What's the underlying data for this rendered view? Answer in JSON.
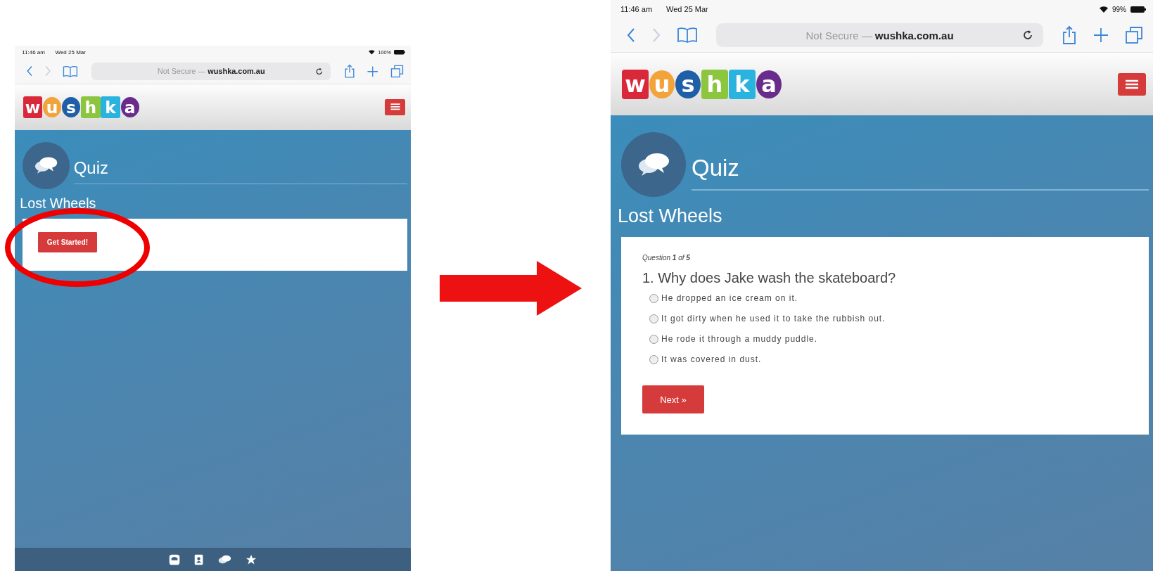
{
  "screens": [
    {
      "kind": "start",
      "status_bar": {
        "time": "11:46 am",
        "date": "Wed 25 Mar",
        "battery": "100%"
      },
      "address_bar": {
        "security": "Not Secure —",
        "domain": "wushka.com.au"
      },
      "logo_letters": [
        {
          "letter": "w",
          "color": "#d9283a",
          "kind": "square"
        },
        {
          "letter": "u",
          "color": "#f2a33a",
          "kind": "circle"
        },
        {
          "letter": "s",
          "color": "#1f5fa8",
          "kind": "circle"
        },
        {
          "letter": "h",
          "color": "#8cc63f",
          "kind": "square"
        },
        {
          "letter": "k",
          "color": "#2bb3e0",
          "kind": "square"
        },
        {
          "letter": "a",
          "color": "#6a2c8c",
          "kind": "circle"
        }
      ],
      "page_title": "Quiz",
      "quiz_title": "Lost Wheels",
      "start_button": "Get Started!"
    },
    {
      "kind": "question",
      "status_bar": {
        "time": "11:46 am",
        "date": "Wed 25 Mar",
        "battery": "99%"
      },
      "address_bar": {
        "security": "Not Secure —",
        "domain": "wushka.com.au"
      },
      "logo_letters": [
        {
          "letter": "w",
          "color": "#d9283a",
          "kind": "square"
        },
        {
          "letter": "u",
          "color": "#f2a33a",
          "kind": "circle"
        },
        {
          "letter": "s",
          "color": "#1f5fa8",
          "kind": "circle"
        },
        {
          "letter": "h",
          "color": "#8cc63f",
          "kind": "square"
        },
        {
          "letter": "k",
          "color": "#2bb3e0",
          "kind": "square"
        },
        {
          "letter": "a",
          "color": "#6a2c8c",
          "kind": "circle"
        }
      ],
      "page_title": "Quiz",
      "quiz_title": "Lost Wheels",
      "question_counter": "Question **1** of **5**",
      "question": "1. Why does Jake wash the skateboard?",
      "options": [
        {
          "label": "He dropped an ice cream on it.",
          "selected": false
        },
        {
          "label": "It got dirty when he used it to take the rubbish out.",
          "selected": false
        },
        {
          "label": "He rode it through a muddy puddle.",
          "selected": false
        },
        {
          "label": "It was covered in dust.",
          "selected": false
        }
      ],
      "next_button": "Next »"
    }
  ]
}
